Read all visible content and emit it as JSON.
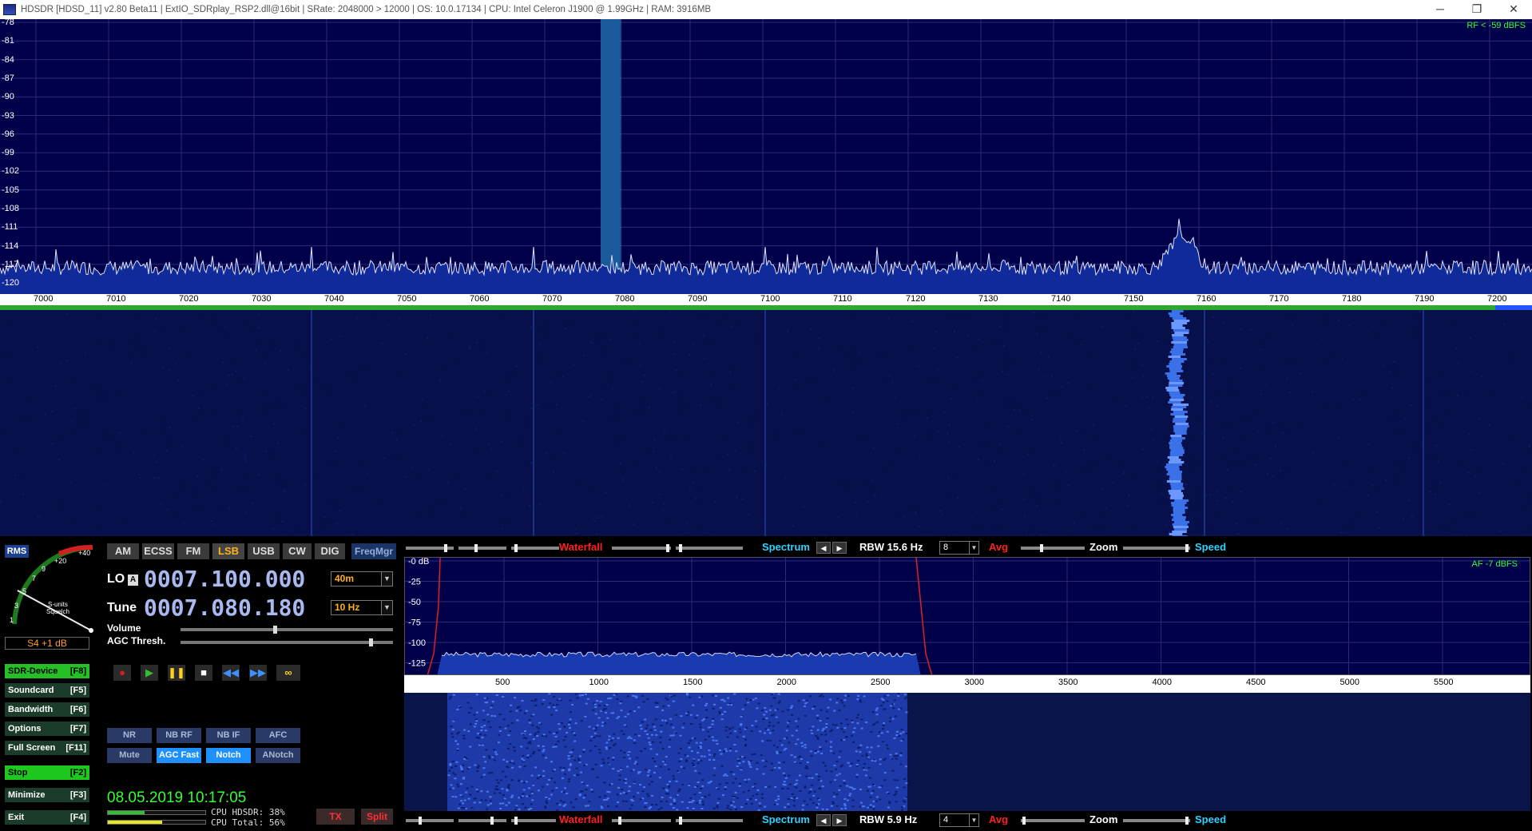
{
  "window": {
    "title": "HDSDR  [HDSD_11]  v2.80 Beta11  |  ExtIO_SDRplay_RSP2.dll@16bit  |  SRate: 2048000 > 12000  |  OS: 10.0.17134   |  CPU: Intel Celeron  J1900  @ 1.99GHz  |  RAM: 3916MB",
    "minimize": "─",
    "restore": "❐",
    "close": "✕"
  },
  "rf_spectrum": {
    "level_label": "RF < -59 dBFS",
    "y_ticks": [
      "-78",
      "-81",
      "-84",
      "-87",
      "-90",
      "-93",
      "-96",
      "-99",
      "-102",
      "-105",
      "-108",
      "-111",
      "-114",
      "-117",
      "-120"
    ],
    "x_ticks": [
      "7000",
      "7010",
      "7020",
      "7030",
      "7040",
      "7050",
      "7060",
      "7070",
      "7080",
      "7090",
      "7100",
      "7110",
      "7120",
      "7130",
      "7140",
      "7150",
      "7160",
      "7170",
      "7180",
      "7190",
      "7200"
    ]
  },
  "smeter": {
    "rms": "RMS",
    "scale_labels": [
      "1",
      "3",
      "5",
      "7",
      "9",
      "+20",
      "+40"
    ],
    "caption_1": "S-units",
    "caption_2": "Squelch",
    "readout": "S4 +1 dB"
  },
  "left_buttons": [
    {
      "label": "SDR-Device",
      "key": "[F8]"
    },
    {
      "label": "Soundcard",
      "key": "[F5]"
    },
    {
      "label": "Bandwidth",
      "key": "[F6]"
    },
    {
      "label": "Options",
      "key": "[F7]"
    },
    {
      "label": "Full Screen",
      "key": "[F11]"
    },
    {
      "label": "Stop",
      "key": "[F2]"
    },
    {
      "label": "Minimize",
      "key": "[F3]"
    },
    {
      "label": "Exit",
      "key": "[F4]"
    }
  ],
  "modes": [
    "AM",
    "ECSS",
    "FM",
    "LSB",
    "USB",
    "CW",
    "DIG"
  ],
  "freqmgr": "FreqMgr",
  "lo": {
    "label": "LO",
    "sub": "A",
    "value": "0007.100.000",
    "band": "40m"
  },
  "tune": {
    "label": "Tune",
    "value": "0007.080.180",
    "step": "10 Hz"
  },
  "volume_label": "Volume",
  "agc_label": "AGC Thresh.",
  "filter_buttons_row1": [
    "NR",
    "NB RF",
    "NB IF",
    "AFC"
  ],
  "filter_buttons_row2": [
    "Mute",
    "AGC Fast",
    "Notch",
    "ANotch"
  ],
  "datetime": "08.05.2019 10:17:05",
  "cpu": {
    "hdsdr": "CPU HDSDR: 38%",
    "total": "CPU Total: 56%"
  },
  "tx_label": "TX",
  "split_label": "Split",
  "rf_controls": {
    "waterfall": "Waterfall",
    "spectrum": "Spectrum",
    "rbw": "RBW 15.6 Hz",
    "avg_value": "8",
    "avg": "Avg",
    "zoom": "Zoom",
    "speed": "Speed"
  },
  "af_controls": {
    "waterfall": "Waterfall",
    "spectrum": "Spectrum",
    "rbw": "RBW  5.9 Hz",
    "avg_value": "4",
    "avg": "Avg",
    "zoom": "Zoom",
    "speed": "Speed"
  },
  "af_spectrum": {
    "level_label": "AF  -7 dBFS",
    "y_ticks": [
      "-0 dB",
      "-25",
      "-50",
      "-75",
      "-100",
      "-125"
    ],
    "x_ticks": [
      "500",
      "1000",
      "1500",
      "2000",
      "2500",
      "3000",
      "3500",
      "4000",
      "4500",
      "5000",
      "5500"
    ]
  },
  "colors": {
    "accent_green": "#33ff33",
    "mode_active": "#ffb020",
    "waterfall_red": "#ff2020",
    "spectrum_cyan": "#30d0ff"
  }
}
